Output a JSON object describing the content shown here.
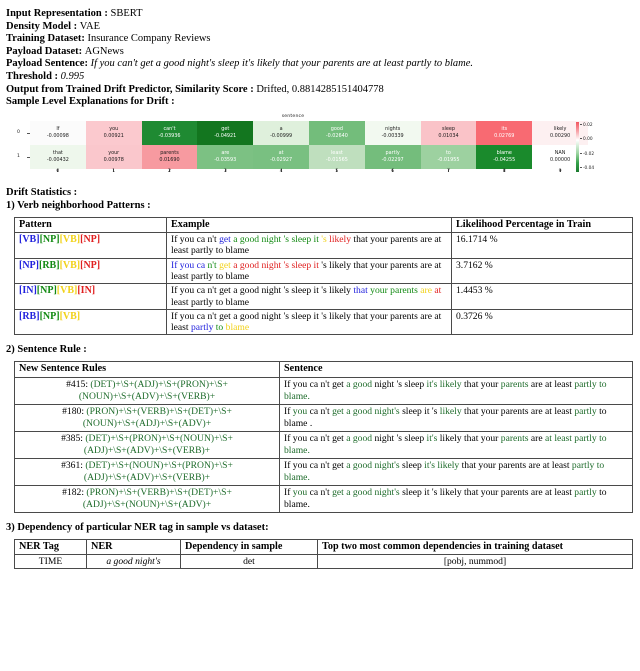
{
  "header": {
    "lines": [
      {
        "label": "Input Representation",
        "sep": " : ",
        "value": "SBERT",
        "italic": false
      },
      {
        "label": "Density Model",
        "sep": " : ",
        "value": "VAE",
        "italic": false
      },
      {
        "label": "Training Dataset",
        "sep": ": ",
        "value": "Insurance Company Reviews",
        "italic": false
      },
      {
        "label": "Payload Dataset",
        "sep": ": ",
        "value": "AGNews",
        "italic": false
      },
      {
        "label": "Payload Sentence",
        "sep": ": ",
        "value": "If you can't get a good night's sleep it's likely that your parents are at least partly to blame.",
        "italic": true
      },
      {
        "label": "Threshold",
        "sep": " : ",
        "value": "0.995",
        "italic": true
      },
      {
        "label": "Output from Trained Drift Predictor, Similarity Score",
        "sep": " : ",
        "value": "Drifted, 0.8814285151404778",
        "italic": false
      },
      {
        "label": "Sample Level Explanations for Drift",
        "sep": " :",
        "value": "",
        "italic": false
      }
    ]
  },
  "chart_data": {
    "type": "heatmap",
    "title": "sentence",
    "xlabel": "",
    "ylabel": "",
    "x": [
      "0",
      "1",
      "2",
      "3",
      "4",
      "5",
      "6",
      "7",
      "8",
      "9"
    ],
    "y": [
      "0",
      "1"
    ],
    "colorbar_ticks": [
      "0.02",
      "0.00",
      "-0.02",
      "-0.04"
    ],
    "colormap": "red-white-green (PiYG-like, red=positive, green=negative)",
    "cells": [
      [
        {
          "word": "If",
          "value": "-0.00098",
          "num": -0.00098,
          "bg": "#fbfbfb",
          "dark": false
        },
        {
          "word": "you",
          "value": "0.00921",
          "num": 0.00921,
          "bg": "#fbc9ce",
          "dark": false
        },
        {
          "word": "can't",
          "value": "-0.03936",
          "num": -0.03936,
          "bg": "#1f8a32",
          "dark": true
        },
        {
          "word": "get",
          "value": "-0.04921",
          "num": -0.04921,
          "bg": "#13761f",
          "dark": true
        },
        {
          "word": "a",
          "value": "-0.00999",
          "num": -0.00999,
          "bg": "#dff0dc",
          "dark": false
        },
        {
          "word": "good",
          "value": "-0.02640",
          "num": -0.0264,
          "bg": "#73bd7b",
          "dark": true
        },
        {
          "word": "nights",
          "value": "-0.00339",
          "num": -0.00339,
          "bg": "#f2f9f0",
          "dark": false
        },
        {
          "word": "sleep",
          "value": "0.01034",
          "num": 0.01034,
          "bg": "#fac3c8",
          "dark": false
        },
        {
          "word": "its",
          "value": "0.02769",
          "num": 0.02769,
          "bg": "#f86a72",
          "dark": true
        },
        {
          "word": "likely",
          "value": "0.00290",
          "num": 0.0029,
          "bg": "#fdf0f1",
          "dark": false
        }
      ],
      [
        {
          "word": "that",
          "value": "-0.00432",
          "num": -0.00432,
          "bg": "#eef7ec",
          "dark": false
        },
        {
          "word": "your",
          "value": "0.00978",
          "num": 0.00978,
          "bg": "#fac7cc",
          "dark": false
        },
        {
          "word": "parents",
          "value": "0.01690",
          "num": 0.0169,
          "bg": "#f79aa0",
          "dark": false
        },
        {
          "word": "are",
          "value": "-0.03593",
          "num": -0.03593,
          "bg": "#7cc183",
          "dark": true
        },
        {
          "word": "at",
          "value": "-0.02927",
          "num": -0.02927,
          "bg": "#79c081",
          "dark": true
        },
        {
          "word": "least",
          "value": "-0.01565",
          "num": -0.01565,
          "bg": "#bfdfbe",
          "dark": true
        },
        {
          "word": "partly",
          "value": "-0.02297",
          "num": -0.02297,
          "bg": "#74bd7c",
          "dark": true
        },
        {
          "word": "to",
          "value": "-0.01955",
          "num": -0.01955,
          "bg": "#9dd1a0",
          "dark": true
        },
        {
          "word": "blame",
          "value": "-0.04255",
          "num": -0.04255,
          "bg": "#1a8a2c",
          "dark": true
        },
        {
          "word": "NAN",
          "value": "0.00000",
          "num": 0.0,
          "bg": "#ffffff",
          "dark": false
        }
      ]
    ]
  },
  "sections": {
    "drift_stats_title": "Drift Statistics :",
    "s1_title": "1) Verb neighborhood Patterns :",
    "s2_title": "2) Sentence Rule :",
    "s3_title": "3) Dependency of particular NER tag in sample vs dataset:"
  },
  "patterns_table": {
    "headers": [
      "Pattern",
      "Example",
      "Likelihood Percentage in Train"
    ],
    "rows": [
      {
        "pattern": [
          {
            "t": "[VB]",
            "c": "blue"
          },
          {
            "t": "[NP]",
            "c": "green"
          },
          {
            "t": "[VB]",
            "c": "yellow"
          },
          {
            "t": "[NP]",
            "c": "red"
          }
        ],
        "example": [
          {
            "t": "If you ca n't ",
            "c": "black"
          },
          {
            "t": "get ",
            "c": "blue"
          },
          {
            "t": "a good night 's sleep it ",
            "c": "green"
          },
          {
            "t": "'s ",
            "c": "yellow"
          },
          {
            "t": "likely",
            "c": "red"
          },
          {
            "t": " that your parents are at least partly to blame",
            "c": "black"
          }
        ],
        "pct": "16.1714 %"
      },
      {
        "pattern": [
          {
            "t": "[NP]",
            "c": "blue"
          },
          {
            "t": "[RB]",
            "c": "green"
          },
          {
            "t": "[VB]",
            "c": "yellow"
          },
          {
            "t": "[NP]",
            "c": "red"
          }
        ],
        "example": [
          {
            "t": "If you ca ",
            "c": "blue"
          },
          {
            "t": "n't ",
            "c": "green"
          },
          {
            "t": "get ",
            "c": "yellow"
          },
          {
            "t": "a good night 's sleep it",
            "c": "red"
          },
          {
            "t": " 's likely that your parents are at least partly to blame",
            "c": "black"
          }
        ],
        "pct": "3.7162 %"
      },
      {
        "pattern": [
          {
            "t": "[IN]",
            "c": "blue"
          },
          {
            "t": "[NP]",
            "c": "green"
          },
          {
            "t": "[VB]",
            "c": "yellow"
          },
          {
            "t": "[IN]",
            "c": "red"
          }
        ],
        "example": [
          {
            "t": "If you ca n't get a good night 's sleep it 's likely ",
            "c": "black"
          },
          {
            "t": "that ",
            "c": "blue"
          },
          {
            "t": "your parents ",
            "c": "green"
          },
          {
            "t": "are ",
            "c": "yellow"
          },
          {
            "t": "at",
            "c": "red"
          },
          {
            "t": " least partly to blame",
            "c": "black"
          }
        ],
        "pct": "1.4453 %"
      },
      {
        "pattern": [
          {
            "t": "[RB]",
            "c": "blue"
          },
          {
            "t": "[NP]",
            "c": "green"
          },
          {
            "t": "[VB]",
            "c": "yellow"
          }
        ],
        "example": [
          {
            "t": "If you ca n't get a good night 's sleep it 's likely that your parents are at least ",
            "c": "black"
          },
          {
            "t": "partly ",
            "c": "blue"
          },
          {
            "t": "to ",
            "c": "green"
          },
          {
            "t": "blame",
            "c": "yellow"
          }
        ],
        "pct": "0.3726 %"
      }
    ]
  },
  "rules_table": {
    "headers": [
      "New Sentence Rules",
      "Sentence"
    ],
    "rows": [
      {
        "id": "#415:",
        "rule_line1": "(DET)+\\S+(ADJ)+\\S+(PRON)+\\S+",
        "rule_line2": "(NOUN)+\\S+(ADV)+\\S+(VERB)+",
        "sentence": [
          {
            "t": "If you ca n't get ",
            "c": "black"
          },
          {
            "t": "a good ",
            "c": "dgreen"
          },
          {
            "t": "night 's sleep ",
            "c": "black"
          },
          {
            "t": "it's likely ",
            "c": "dgreen"
          },
          {
            "t": "that your ",
            "c": "black"
          },
          {
            "t": "parents ",
            "c": "dgreen"
          },
          {
            "t": "are at least ",
            "c": "black"
          },
          {
            "t": "partly to blame.",
            "c": "dgreen"
          }
        ]
      },
      {
        "id": "#180:",
        "rule_line1": "(PRON)+\\S+(VERB)+\\S+(DET)+\\S+",
        "rule_line2": "(NOUN)+\\S+(ADJ)+\\S+(ADV)+",
        "sentence": [
          {
            "t": "If ",
            "c": "black"
          },
          {
            "t": "you ",
            "c": "dgreen"
          },
          {
            "t": "ca n't ",
            "c": "black"
          },
          {
            "t": "get a good ",
            "c": "dgreen"
          },
          {
            "t": "night's ",
            "c": "dgreen"
          },
          {
            "t": "sleep it 's ",
            "c": "black"
          },
          {
            "t": "likely ",
            "c": "dgreen"
          },
          {
            "t": "that your parents are at least ",
            "c": "black"
          },
          {
            "t": "partly ",
            "c": "dgreen"
          },
          {
            "t": "to blame .",
            "c": "black"
          }
        ]
      },
      {
        "id": "#385:",
        "rule_line1": "(DET)+\\S+(PRON)+\\S+(NOUN)+\\S+",
        "rule_line2": "(ADJ)+\\S+(ADV)+\\S+(VERB)+",
        "sentence": [
          {
            "t": "If you ca n't get ",
            "c": "black"
          },
          {
            "t": "a good ",
            "c": "dgreen"
          },
          {
            "t": "night 's sleep ",
            "c": "black"
          },
          {
            "t": "it's ",
            "c": "dgreen"
          },
          {
            "t": "likely that your ",
            "c": "black"
          },
          {
            "t": "parents ",
            "c": "dgreen"
          },
          {
            "t": "are ",
            "c": "black"
          },
          {
            "t": "at least partly to blame.",
            "c": "dgreen"
          }
        ]
      },
      {
        "id": "#361:",
        "rule_line1": "(DET)+\\S+(NOUN)+\\S+(PRON)+\\S+",
        "rule_line2": "(ADJ)+\\S+(ADV)+\\S+(VERB)+",
        "sentence": [
          {
            "t": "If you ca n't get ",
            "c": "black"
          },
          {
            "t": "a good ",
            "c": "dgreen"
          },
          {
            "t": "night's ",
            "c": "dgreen"
          },
          {
            "t": "sleep ",
            "c": "black"
          },
          {
            "t": "it's likely ",
            "c": "dgreen"
          },
          {
            "t": "that your parents are at least ",
            "c": "black"
          },
          {
            "t": "partly to blame.",
            "c": "dgreen"
          }
        ]
      },
      {
        "id": "#182:",
        "rule_line1": "(PRON)+\\S+(VERB)+\\S+(DET)+\\S+",
        "rule_line2": "(ADJ)+\\S+(NOUN)+\\S+(ADV)+",
        "sentence": [
          {
            "t": "If ",
            "c": "black"
          },
          {
            "t": "you ",
            "c": "dgreen"
          },
          {
            "t": "ca n't ",
            "c": "black"
          },
          {
            "t": "get a good night's ",
            "c": "dgreen"
          },
          {
            "t": "sleep it 's likely that your ",
            "c": "black"
          },
          {
            "t": "parents are at least ",
            "c": "black"
          },
          {
            "t": "partly ",
            "c": "dgreen"
          },
          {
            "t": "to blame.",
            "c": "black"
          }
        ]
      }
    ]
  },
  "ner_table": {
    "headers": [
      "NER Tag",
      "NER",
      "Dependency in sample",
      "Top two most common dependencies in training dataset"
    ],
    "rows": [
      {
        "tag": "TIME",
        "ner": "a good night's",
        "dep": "det",
        "top": "[pobj, nummod]"
      }
    ]
  }
}
